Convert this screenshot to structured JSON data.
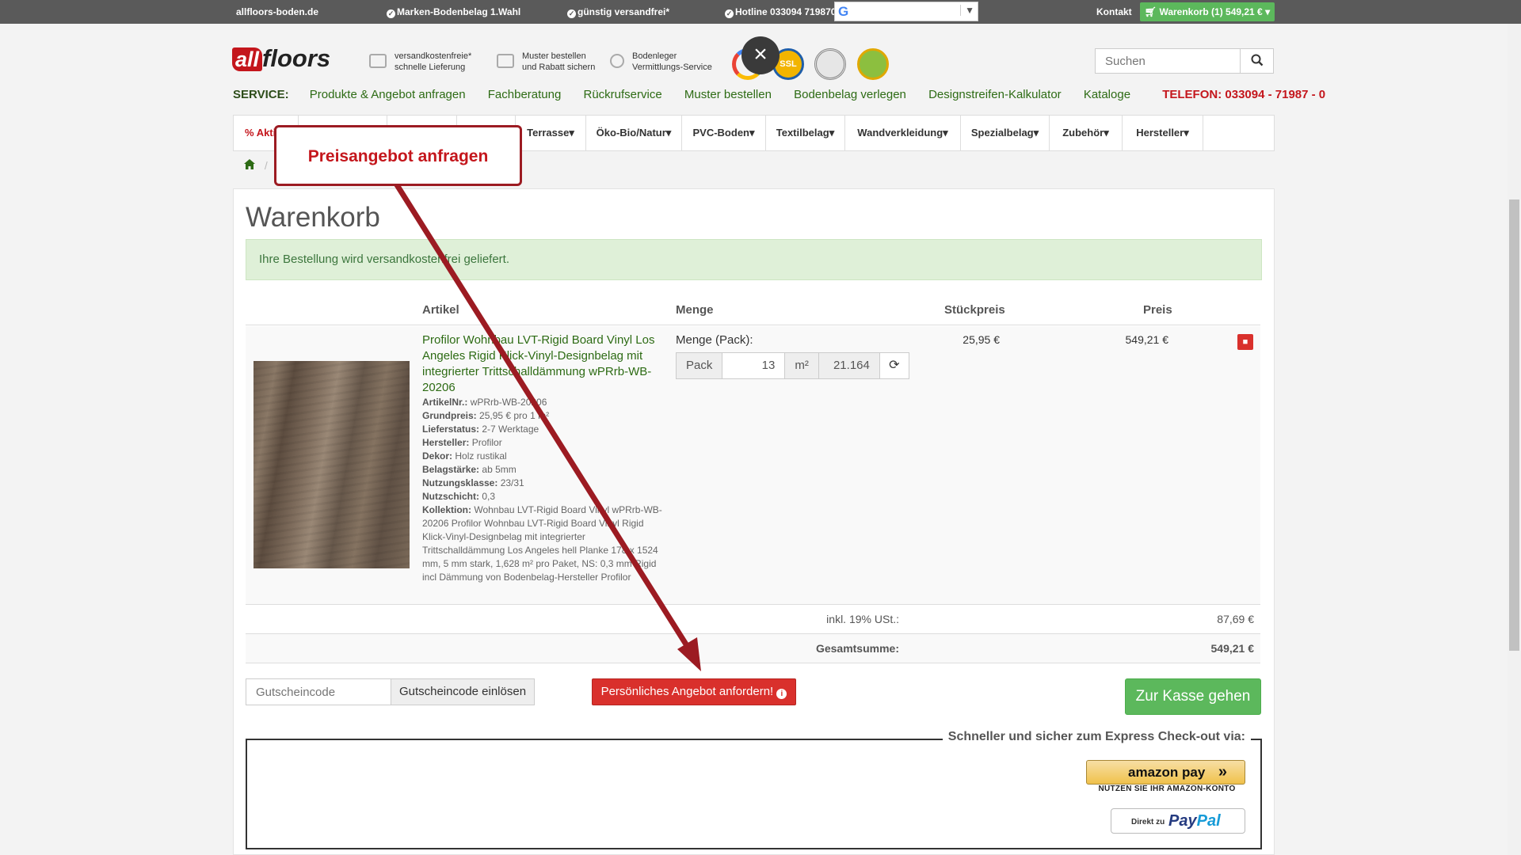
{
  "topbar": {
    "site": "allfloors-boden.de",
    "usp1": "Marken-Bodenbelag 1.Wahl",
    "usp2": "günstig versandfrei*",
    "hotline": "Hotline 033094 719870",
    "kontakt": "Kontakt",
    "cart": "Warenkorb (1) 549,21 €"
  },
  "logo": {
    "all": "all",
    "floors": "floors"
  },
  "benefits": [
    {
      "line1": "versandkostenfreie*",
      "line2": "schnelle Lieferung",
      "icon": "truck-icon"
    },
    {
      "line1": "Muster bestellen",
      "line2": "und Rabatt sichern",
      "icon": "card-icon"
    },
    {
      "line1": "Bodenleger",
      "line2": "Vermittlungs-Service",
      "icon": "person-icon"
    }
  ],
  "seals": {
    "ssl": "SSL"
  },
  "search": {
    "placeholder": "Suchen"
  },
  "service": {
    "label": "SERVICE:",
    "links": [
      "Produkte & Angebot anfragen",
      "Fachberatung",
      "Rückrufservice",
      "Muster bestellen",
      "Bodenbelag verlegen",
      "Designstreifen-Kalkulator",
      "Kataloge"
    ],
    "phone": "TELEFON: 033094 - 71987 - 0"
  },
  "catnav": [
    "% Akti",
    "Terrasse",
    "Öko-Bio/Natur",
    "PVC-Boden",
    "Textilbelag",
    "Wandverkleidung",
    "Spezialbelag",
    "Zubehör",
    "Hersteller"
  ],
  "cart": {
    "title": "Warenkorb",
    "alert": "Ihre Bestellung wird versandkostenfrei geliefert.",
    "headers": {
      "artikel": "Artikel",
      "menge": "Menge",
      "stueckpreis": "Stückpreis",
      "preis": "Preis"
    },
    "item": {
      "name": "Profilor Wohnbau LVT-Rigid Board Vinyl Los Angeles Rigid Klick-Vinyl-Designbelag mit integrierter Trittschalldämmung wPRrb-WB-20206",
      "details": [
        {
          "k": "ArtikelNr.:",
          "v": "wPRrb-WB-20206"
        },
        {
          "k": "Grundpreis:",
          "v": "25,95 € pro 1 m²"
        },
        {
          "k": "Lieferstatus:",
          "v": "2-7 Werktage"
        },
        {
          "k": "Hersteller:",
          "v": "Profilor"
        },
        {
          "k": "Dekor:",
          "v": "Holz rustikal"
        },
        {
          "k": "Belagstärke:",
          "v": "ab 5mm"
        },
        {
          "k": "Nutzungsklasse:",
          "v": "23/31"
        },
        {
          "k": "Nutzschicht:",
          "v": "0,3"
        },
        {
          "k": "Kollektion:",
          "v": "Wohnbau LVT-Rigid Board Vinyl wPRrb-WB-20206 Profilor Wohnbau LVT-Rigid Board Vinyl Rigid Klick-Vinyl-Designbelag mit integrierter Trittschalldämmung Los Angeles hell Planke 178 x 1524 mm, 5 mm stark, 1,628 m² pro Paket, NS: 0,3 mm Rigid incl Dämmung von Bodenbelag-Hersteller Profilor"
        }
      ],
      "menge_label": "Menge (Pack):",
      "pack_label": "Pack",
      "pack_value": "13",
      "m2_label": "m²",
      "m2_value": "21.164",
      "stueckpreis": "25,95 €",
      "preis": "549,21 €"
    },
    "tax_label": "inkl. 19% USt.:",
    "tax_value": "87,69 €",
    "total_label": "Gesamtsumme:",
    "total_value": "549,21 €",
    "coupon_placeholder": "Gutscheincode",
    "coupon_button": "Gutscheincode einlösen",
    "offer_button": "Persönliches Angebot anfordern!",
    "checkout_button": "Zur Kasse gehen",
    "express_legend": "Schneller und sicher zum Express Check-out via:",
    "amazon_label": "amazon pay",
    "amazon_note": "NUTZEN SIE IHR AMAZON-KONTO",
    "paypal_prefix": "Direkt zu",
    "paypal_pay": "Pay",
    "paypal_pal": "Pal"
  },
  "callout": {
    "text": "Preisangebot anfragen"
  },
  "colors": {
    "brand_red": "#c4161c",
    "green": "#5cb85c",
    "link_green": "#2d6b14",
    "arrow": "#9c1b22"
  }
}
